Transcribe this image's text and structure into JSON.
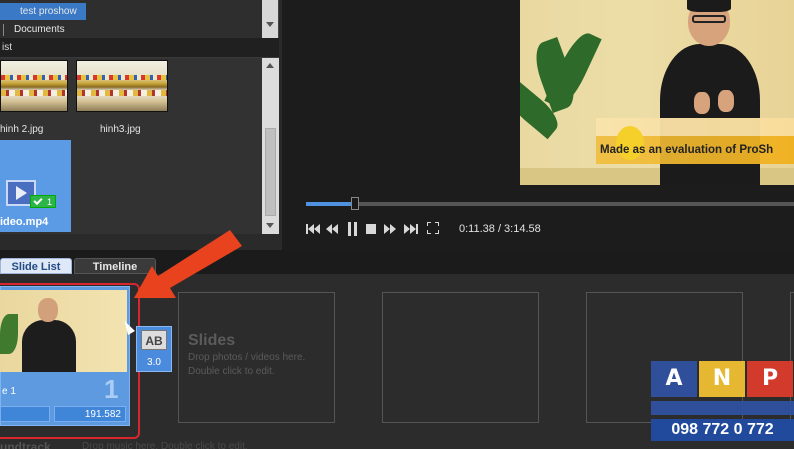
{
  "folder_tree": {
    "selected_folder": "test proshow",
    "documents": "Documents"
  },
  "file_list": {
    "header_label": "ist",
    "files": [
      {
        "name": "hinh 2.jpg"
      },
      {
        "name": "hinh3.jpg"
      },
      {
        "name": "ideo.mp4",
        "used_count": "1"
      }
    ]
  },
  "preview": {
    "caption_text": "Made as an evaluation of  ProSh",
    "time_display": "0:11.38 / 3:14.58",
    "progress": 0.1
  },
  "controls": [
    {
      "name": "skip-to-start-button"
    },
    {
      "name": "rewind-button"
    },
    {
      "name": "pause-button"
    },
    {
      "name": "stop-button"
    },
    {
      "name": "fast-forward-button"
    },
    {
      "name": "skip-to-end-button"
    },
    {
      "name": "fullscreen-button"
    }
  ],
  "tabs": {
    "slide_list": "Slide List",
    "timeline": "Timeline"
  },
  "slide_list": {
    "slide": {
      "name": "e 1",
      "number": "1",
      "duration": "191.582"
    },
    "transition": {
      "label": "AB",
      "duration": "3.0"
    },
    "empty_title": "Slides",
    "empty_hint_1": "Drop photos / videos here.",
    "empty_hint_2": "Double click to edit.",
    "soundtrack_label": "undtrack",
    "soundtrack_hint": "Drop music here.  Double click to edit."
  },
  "watermark": {
    "letters": [
      "A",
      "N",
      "P"
    ],
    "phone": "098 772 0 772",
    "colors": {
      "a": "#2f4f9b",
      "n": "#e6b832",
      "p": "#d23a2c"
    }
  },
  "annotation_color": "#e8421f"
}
